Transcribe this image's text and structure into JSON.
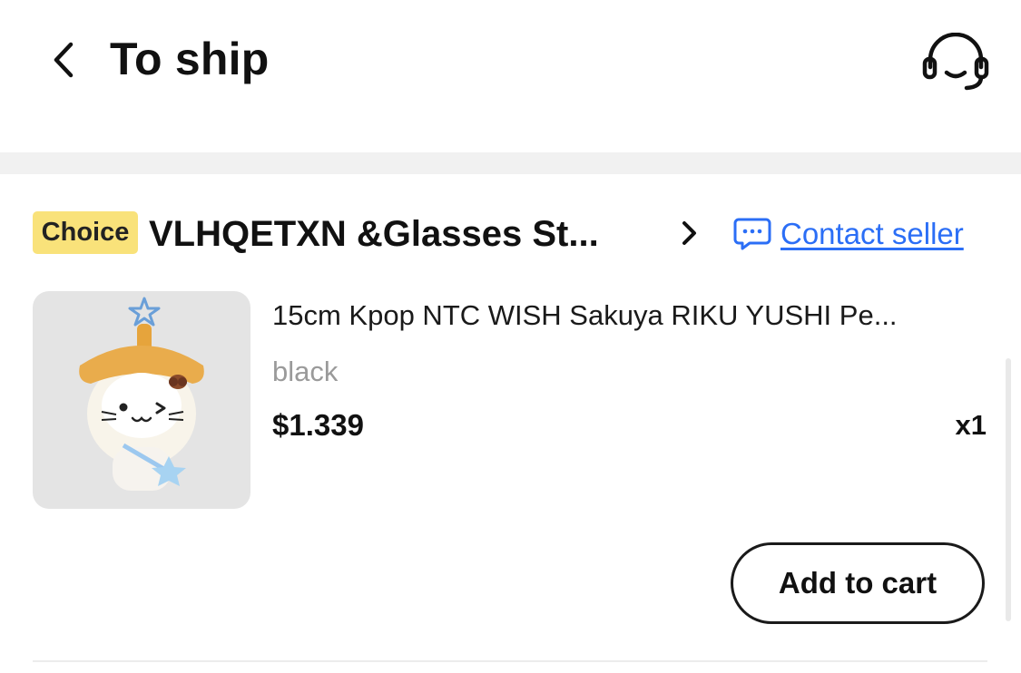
{
  "header": {
    "title": "To ship",
    "back_icon": "chevron-left-icon",
    "support_icon": "headset-support-icon"
  },
  "store": {
    "badge": "Choice",
    "name": "VLHQETXN &Glasses St...",
    "chevron_icon": "chevron-right-icon",
    "contact_icon": "chat-bubble-icon",
    "contact_label": "Contact seller"
  },
  "product": {
    "title": "15cm Kpop NTC WISH Sakuya RIKU YUSHI Pe...",
    "variant": "black",
    "price": "$1.339",
    "quantity": "x1"
  },
  "actions": {
    "add_to_cart_label": "Add to cart"
  },
  "colors": {
    "badge_bg": "#f9e27a",
    "link_blue": "#2b6ef6",
    "separator_band": "#f1f1f1",
    "thumbnail_bg": "#e4e4e4"
  }
}
